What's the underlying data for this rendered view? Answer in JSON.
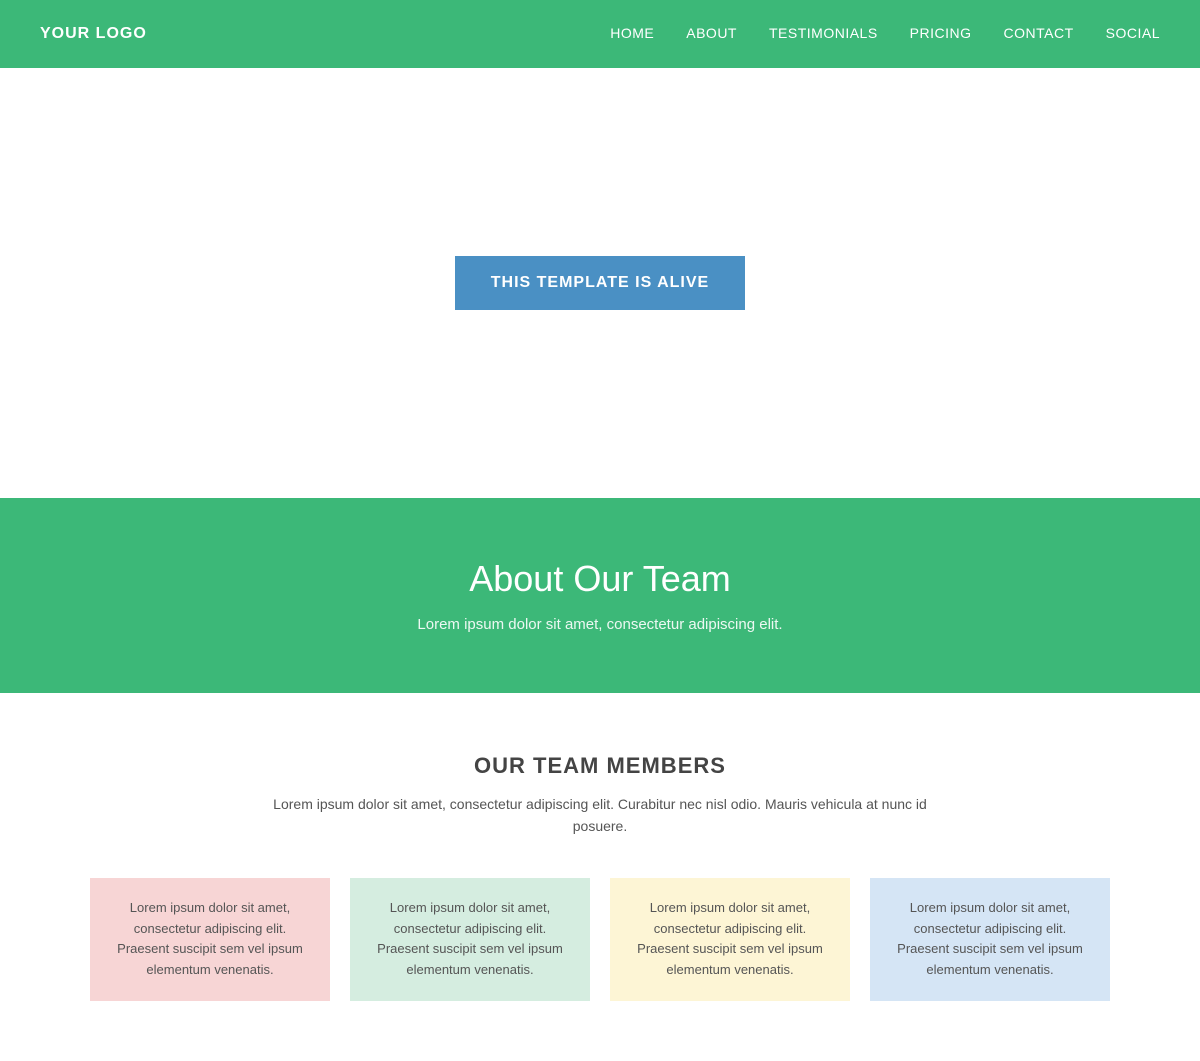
{
  "nav": {
    "logo": "YOUR LOGO",
    "links": [
      {
        "label": "HOME",
        "href": "#"
      },
      {
        "label": "ABOUT",
        "href": "#"
      },
      {
        "label": "TESTIMONIALS",
        "href": "#"
      },
      {
        "label": "PRICING",
        "href": "#"
      },
      {
        "label": "CONTACT",
        "href": "#"
      },
      {
        "label": "SOCIAL",
        "href": "#"
      }
    ]
  },
  "hero": {
    "button_label": "THIS TEMPLATE IS ALIVE"
  },
  "about": {
    "title": "About Our Team",
    "subtitle": "Lorem ipsum dolor sit amet, consectetur adipiscing elit."
  },
  "team": {
    "heading": "OUR TEAM MEMBERS",
    "description": "Lorem ipsum dolor sit amet, consectetur adipiscing elit. Curabitur nec nisl odio. Mauris vehicula at nunc id posuere.",
    "cards": [
      {
        "text": "Lorem ipsum dolor sit amet, consectetur adipiscing elit. Praesent suscipit sem vel ipsum elementum venenatis.",
        "color": "pink"
      },
      {
        "text": "Lorem ipsum dolor sit amet, consectetur adipiscing elit. Praesent suscipit sem vel ipsum elementum venenatis.",
        "color": "mint"
      },
      {
        "text": "Lorem ipsum dolor sit amet, consectetur adipiscing elit. Praesent suscipit sem vel ipsum elementum venenatis.",
        "color": "yellow"
      },
      {
        "text": "Lorem ipsum dolor sit amet, consectetur adipiscing elit. Praesent suscipit sem vel ipsum elementum venenatis.",
        "color": "blue"
      }
    ]
  }
}
